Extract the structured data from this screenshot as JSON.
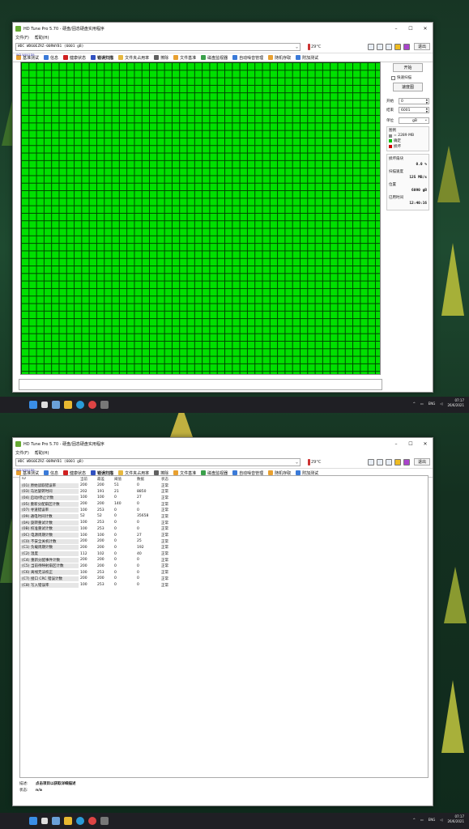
{
  "colors": {
    "scan_ok": "#00e000",
    "grid_line": "#004400",
    "taskbar": "#1f1f24"
  },
  "window_top": {
    "title": "HD Tune Pro 5.70 - 硬盘/固态硬盘实用程序",
    "menu": [
      "文件(F)",
      "帮助(H)"
    ],
    "drive": "WDC WD60EZRZ-00RWYB1 (6001 gB)",
    "drive_sub": "WD-WX41D9...",
    "temperature": "29°C",
    "exit_label": "退出",
    "tabs": [
      {
        "label": "基准测试",
        "icon": "benchmark-icon",
        "color": "#e8a030"
      },
      {
        "label": "信息",
        "icon": "info-icon",
        "color": "#3a7ad8"
      },
      {
        "label": "健康状态",
        "icon": "health-icon",
        "color": "#d02020"
      },
      {
        "label": "错误扫描",
        "icon": "scan-icon",
        "color": "#3050c0",
        "active": true
      },
      {
        "label": "文件夹占用率",
        "icon": "folder-icon",
        "color": "#e6b840"
      },
      {
        "label": "擦除",
        "icon": "erase-icon",
        "color": "#606060"
      },
      {
        "label": "文件基准",
        "icon": "file-icon",
        "color": "#e8a030"
      },
      {
        "label": "磁盘监视器",
        "icon": "monitor-icon",
        "color": "#3aa04a"
      },
      {
        "label": "自动噪音管理",
        "icon": "noise-icon",
        "color": "#3a7ad8"
      },
      {
        "label": "随机存取",
        "icon": "random-icon",
        "color": "#e8a030"
      },
      {
        "label": "附加测试",
        "icon": "extra-icon",
        "color": "#3a7ad8"
      }
    ],
    "panel": {
      "start_btn": "开始",
      "quick_scan": "快速扫描",
      "speed_map_btn": "速度图",
      "start_label": "开始",
      "start_value": "0",
      "end_label": "结束",
      "end_value": "6001",
      "unit_label": "单位",
      "unit_value": "gB",
      "legend_title": "图例",
      "legend": [
        {
          "label": "= 2289 MB",
          "color": "#888888"
        },
        {
          "label": "确定",
          "color": "#00c000"
        },
        {
          "label": "损坏",
          "color": "#d00000"
        }
      ],
      "damaged_label": "损坏扇块",
      "damaged_value": "0.0 %",
      "speed_label": "扫描速度",
      "speed_value": "125 MB/s",
      "position_label": "位置",
      "position_value": "6090 gB",
      "elapsed_label": "已用时间",
      "elapsed_value": "12:40:16"
    }
  },
  "window_bottom": {
    "title": "HD Tune Pro 5.70 - 硬盘/固态硬盘实用程序",
    "menu": [
      "文件(F)",
      "帮助(H)"
    ],
    "drive": "WDC WD60EZRZ-00RWYB1 (6001 gB)",
    "drive_sub": "WD-WX41D9...",
    "temperature": "29°C",
    "exit_label": "退出",
    "columns": [
      "ID",
      "当前",
      "最差",
      "阈值",
      "数据",
      "状态"
    ],
    "rows": [
      [
        "(01) 原始读取错误率",
        "200",
        "200",
        "51",
        "0",
        "正常"
      ],
      [
        "(03) 马达旋转时间",
        "202",
        "191",
        "21",
        "8850",
        "正常"
      ],
      [
        "(04) 启动/停止计数",
        "100",
        "100",
        "0",
        "27",
        "正常"
      ],
      [
        "(05) 重新分配扇区计数",
        "200",
        "200",
        "140",
        "0",
        "正常"
      ],
      [
        "(07) 寻道错误率",
        "100",
        "253",
        "0",
        "0",
        "正常"
      ],
      [
        "(09) 通电时间计数",
        "52",
        "52",
        "0",
        "35658",
        "正常"
      ],
      [
        "(0A) 旋转重试计数",
        "100",
        "253",
        "0",
        "0",
        "正常"
      ],
      [
        "(0B) 校准重试计数",
        "100",
        "253",
        "0",
        "0",
        "正常"
      ],
      [
        "(0C) 电源周期计数",
        "100",
        "100",
        "0",
        "27",
        "正常"
      ],
      [
        "(C0) 不安全关机计数",
        "200",
        "200",
        "0",
        "25",
        "正常"
      ],
      [
        "(C1) 负载周期计数",
        "200",
        "200",
        "0",
        "192",
        "正常"
      ],
      [
        "(C2) 温度",
        "112",
        "102",
        "0",
        "40",
        "正常"
      ],
      [
        "(C4) 重新分配事件计数",
        "200",
        "200",
        "0",
        "0",
        "正常"
      ],
      [
        "(C5) 当前待映射扇区计数",
        "200",
        "200",
        "0",
        "0",
        "正常"
      ],
      [
        "(C6) 离线无法校正",
        "100",
        "253",
        "0",
        "0",
        "正常"
      ],
      [
        "(C7) 接口 CRC 错误计数",
        "200",
        "200",
        "0",
        "0",
        "正常"
      ],
      [
        "(C8) 写入错误率",
        "100",
        "253",
        "0",
        "0",
        "正常"
      ]
    ],
    "desc_label": "描述:",
    "desc_value": "点击项目以获取详细描述",
    "status_label": "状态:",
    "status_value": "n/a"
  },
  "taskbar": {
    "lang": "ENG",
    "time": "07:17",
    "date": "26/6/2021"
  }
}
